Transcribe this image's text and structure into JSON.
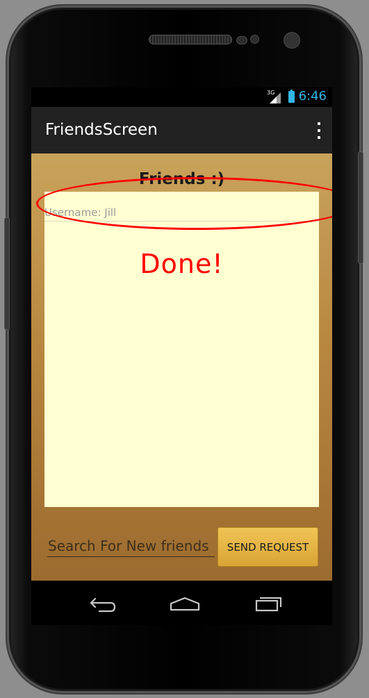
{
  "status_bar": {
    "network": "3G",
    "time": "6:46"
  },
  "action_bar": {
    "title": "FriendsScreen",
    "overflow_icon": "overflow-menu-icon"
  },
  "friends": {
    "title": "Friends :)",
    "items": [
      "Username: Jill"
    ]
  },
  "annotation": {
    "text": "Done!",
    "color": "#ff0000"
  },
  "search": {
    "placeholder": "Search For New friends",
    "value": ""
  },
  "send_button": {
    "label": "SEND REQUEST"
  },
  "nav": {
    "back_icon": "back-icon",
    "home_icon": "home-icon",
    "recents_icon": "recents-icon"
  },
  "colors": {
    "accent": "#33b5e5",
    "action_bar": "#222222",
    "panel": "#ffffd2",
    "button": "#e0ac3a"
  }
}
